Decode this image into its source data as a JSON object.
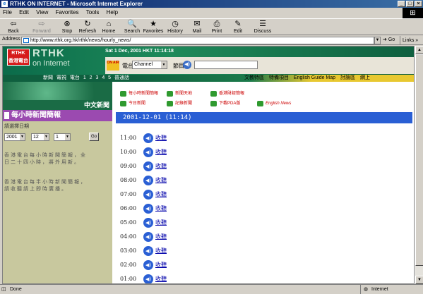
{
  "window": {
    "title": "RTHK ON INTERNET - Microsoft Internet Explorer",
    "minimize": "_",
    "maximize": "□",
    "close": "×"
  },
  "menu": [
    "File",
    "Edit",
    "View",
    "Favorites",
    "Tools",
    "Help"
  ],
  "toolbar": [
    {
      "label": "Back",
      "icon": "back-arrow-icon",
      "glyph": "⇦"
    },
    {
      "label": "Forward",
      "icon": "forward-arrow-icon",
      "glyph": "⇨"
    },
    {
      "label": "Stop",
      "icon": "stop-icon",
      "glyph": "⊗"
    },
    {
      "label": "Refresh",
      "icon": "refresh-icon",
      "glyph": "↻"
    },
    {
      "label": "Home",
      "icon": "home-icon",
      "glyph": "⌂"
    },
    {
      "label": "Search",
      "icon": "search-icon",
      "glyph": "🔍"
    },
    {
      "label": "Favorites",
      "icon": "favorites-icon",
      "glyph": "★"
    },
    {
      "label": "History",
      "icon": "history-icon",
      "glyph": "◷"
    },
    {
      "label": "Mail",
      "icon": "mail-icon",
      "glyph": "✉"
    },
    {
      "label": "Print",
      "icon": "print-icon",
      "glyph": "⎙"
    },
    {
      "label": "Edit",
      "icon": "edit-icon",
      "glyph": "✎"
    },
    {
      "label": "Discuss",
      "icon": "discuss-icon",
      "glyph": "☰"
    }
  ],
  "address": {
    "label": "Address",
    "url": "http://www.rthk.org.hk/rthk/news/hourly_news/",
    "go": "Go",
    "links": "Links"
  },
  "site": {
    "logo_line1": "RTHK",
    "logo_line2": "香港電台",
    "brand": "RTHK",
    "brand_sub": "on Internet",
    "datetime": "Sat 1 Dec, 2001 HKT 11:14:18",
    "onair": "ON AIR",
    "channel_label": "電台",
    "channel_value": "Channel",
    "time_label": "節目",
    "nav_left": "新聞 電視 電台 1 2 3 4 5 普通話",
    "nav_right": [
      "文教特區",
      "特備項目",
      "English Guide Map",
      "討論區",
      "網上"
    ],
    "zh_news": "中文新聞",
    "quick_links": [
      "每小時新聞簡報",
      "新聞天地",
      "香港財經簡報",
      "今日新聞",
      "記錄新聞",
      "下載PDA版",
      "English News"
    ]
  },
  "sidebar": {
    "title": "每小時新聞簡報",
    "select_date": "請選擇日期",
    "year": "2001",
    "month": "12",
    "day": "1",
    "go": "Go",
    "para1": "香港電台每小時新聞簡報，全日二十四小時，將外用新。",
    "para2": "香港電台每半小時新聞簡報，請收聽請上即時廣播。"
  },
  "main": {
    "date_header": "2001-12-01 (11:14)",
    "listen": "收聽",
    "times": [
      "11:00",
      "10:00",
      "09:00",
      "08:00",
      "07:00",
      "06:00",
      "05:00",
      "04:00",
      "03:00",
      "02:00",
      "01:00"
    ]
  },
  "status": {
    "text": "Done",
    "zone": "Internet"
  }
}
